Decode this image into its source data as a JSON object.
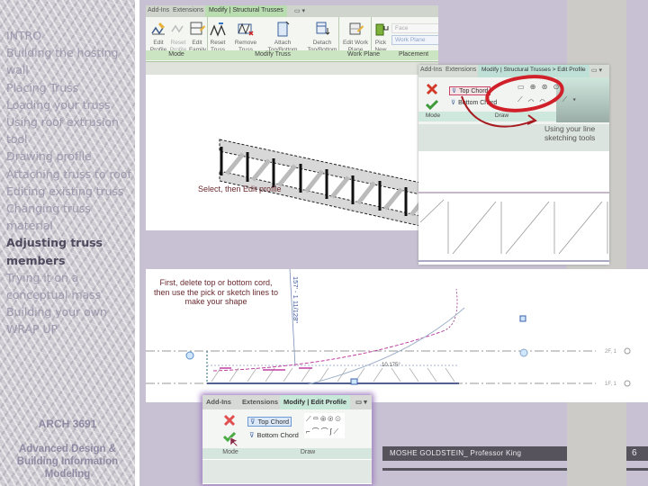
{
  "sidebar": {
    "nav_items": [
      {
        "label": "INTRO",
        "active": false
      },
      {
        "label": "Building the hosting wall",
        "active": false
      },
      {
        "label": "Placing Truss",
        "active": false
      },
      {
        "label": "Loading your truss",
        "active": false
      },
      {
        "label": "Using roof extrusion tool",
        "active": false
      },
      {
        "label": "Drawing profile",
        "active": false
      },
      {
        "label": "Attaching truss to roof",
        "active": false
      },
      {
        "label": "Editing existing truss",
        "active": false
      },
      {
        "label": "Changing truss material",
        "active": false
      },
      {
        "label": "Adjusting truss members",
        "active": true
      },
      {
        "label": "Trying it on a conceptual mass",
        "active": false
      },
      {
        "label": "Building your own",
        "active": false
      },
      {
        "label": "WRAP UP",
        "active": false
      }
    ],
    "course_code": "ARCH 3691",
    "course_name": "Advanced Design & Building Information Modeling"
  },
  "ribbon_top": {
    "tabs": [
      "Add-Ins",
      "Extensions",
      "Modify | Structural Trusses",
      "▭ ▾"
    ],
    "buttons": [
      {
        "label": "Edit Profile",
        "icon": "edit-profile-icon"
      },
      {
        "label": "Reset Profile",
        "icon": "reset-profile-icon"
      },
      {
        "label": "Edit Family",
        "icon": "edit-family-icon"
      },
      {
        "label": "Reset Truss",
        "icon": "reset-truss-icon"
      },
      {
        "label": "Remove Truss Family",
        "icon": "remove-truss-family-icon"
      },
      {
        "label": "Attach Top/Bottom",
        "icon": "attach-icon"
      },
      {
        "label": "Detach Top/Bottom",
        "icon": "detach-icon"
      },
      {
        "label": "Edit Work Plane",
        "icon": "edit-work-plane-icon"
      },
      {
        "label": "Pick New",
        "icon": "pick-new-icon"
      }
    ],
    "placement_fields": [
      "Face",
      "Work Plane"
    ],
    "groups": [
      "Mode",
      "Modify Truss",
      "Work Plane",
      "Placement"
    ],
    "caption": "Select, then Edit profile"
  },
  "callout": {
    "tabs": [
      "Add-Ins",
      "Extensions",
      "Modify | Structural Trusses > Edit Profile",
      "▭ ▾"
    ],
    "commands": [
      "Top Chord",
      "Bottom Chord"
    ],
    "groups": [
      "Mode",
      "Draw"
    ],
    "note": "Using your line sketching tools"
  },
  "sketch": {
    "instruction": "First, delete top or bottom cord, then use the pick or sketch lines to make your shape",
    "dimension": "157' - 1 11/128\"",
    "angle": "10.175°",
    "level_labels": [
      "2F, 1",
      "1F, 1"
    ]
  },
  "bottom_shot": {
    "tabs": [
      "Add-Ins",
      "Extensions",
      "Modify | Edit Profile",
      "▭ ▾"
    ],
    "commands": [
      "Top Chord",
      "Bottom Chord"
    ],
    "groups": [
      "Mode",
      "Draw"
    ]
  },
  "footer": {
    "author": "MOSHE GOLDSTEIN_ Professor King",
    "page_number": "6"
  },
  "colors": {
    "background": "#c8c1d3",
    "footer_bar": "#56535d",
    "nav_active": "#4f4a5e",
    "nav_inactive": "#9d98ad",
    "ribbon_green": "#b9dcb0",
    "callout_red": "#d0202a"
  }
}
